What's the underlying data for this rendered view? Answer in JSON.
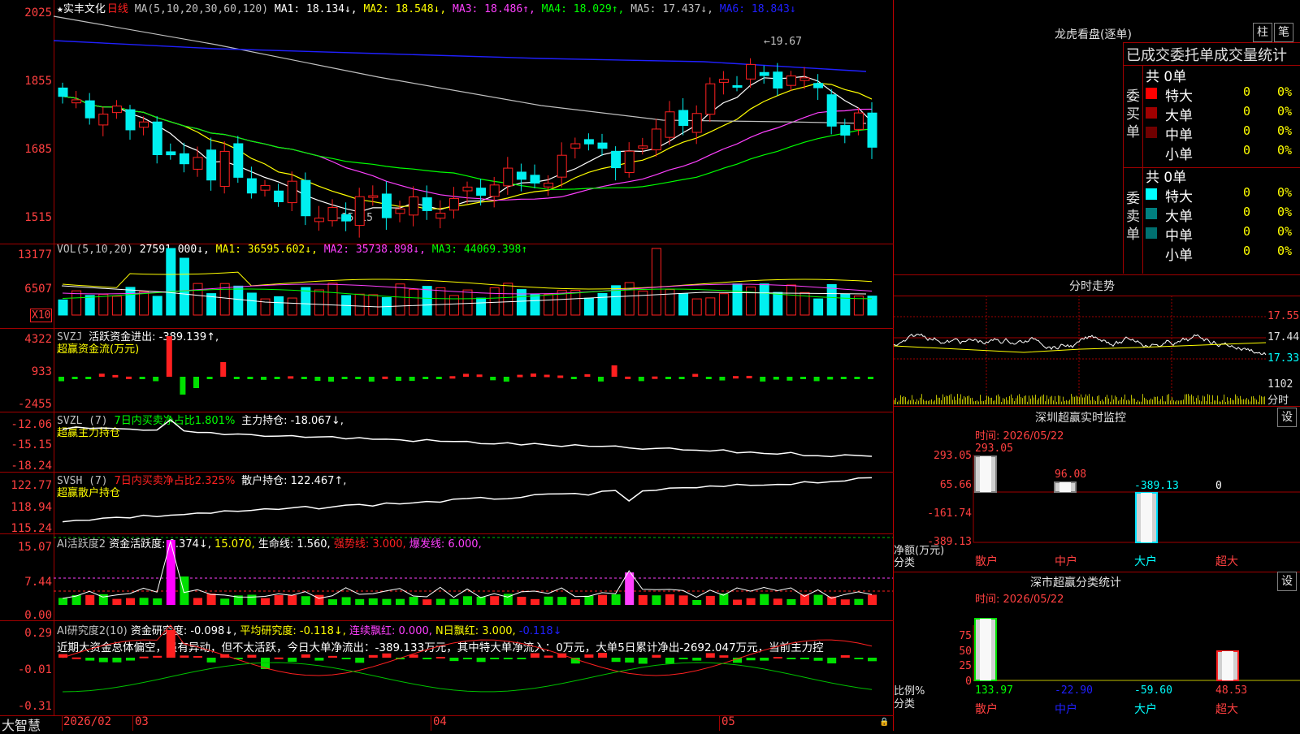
{
  "colors": {
    "up": "#ff2020",
    "down": "#00f0f0",
    "ma1": "#ffffff",
    "ma2": "#ffff00",
    "ma3": "#ff40ff",
    "ma4": "#00ff00",
    "ma5": "#c0c0c0",
    "ma6": "#2020ff"
  },
  "kline": {
    "title_star": "★",
    "stock": "实丰文化",
    "period": "日线",
    "ma_params": "MA(5,10,20,30,60,120)",
    "ma1": "MA1: 18.134↓,",
    "ma2": "MA2: 18.548↓,",
    "ma3": "MA3: 18.486↑,",
    "ma4": "MA4: 18.029↑,",
    "ma5": "MA5: 17.437↓,",
    "ma6": "MA6: 18.843↓",
    "yticks": [
      "2025",
      "1855",
      "1685",
      "1515"
    ],
    "high_mark": "19.67",
    "low_mark": "15.15"
  },
  "vol": {
    "title": "VOL(5,10,20)",
    "value": "27591.000↓,",
    "ma1": "MA1: 36595.602↓,",
    "ma2": "MA2: 35738.898↓,",
    "ma3": "MA3: 44069.398↑",
    "yticks": [
      "13177",
      "6507"
    ],
    "unit": "X10"
  },
  "svzj": {
    "title": "SVZJ",
    "label": "活跃资金进出: -389.139↑,",
    "sub": "超赢资金流(万元)",
    "yticks": [
      "4322",
      "933",
      "-2455"
    ]
  },
  "svzl": {
    "title": "SVZL (7)",
    "label1": "7日内买卖净占比1.801%",
    "label2": "主力持仓: -18.067↓,",
    "sub": "超赢主力持仓",
    "yticks": [
      "-12.06",
      "-15.15",
      "-18.24"
    ]
  },
  "svsh": {
    "title": "SVSH (7)",
    "label1": "7日内买卖净占比2.325%",
    "label2": "散户持仓: 122.467↑,",
    "sub": "超赢散户持仓",
    "yticks": [
      "122.77",
      "118.94",
      "115.24"
    ]
  },
  "ai1": {
    "title": "AI活跃度2",
    "l1": "资金活跃度: 0.374↓,",
    "l2": "15.070,",
    "l3": "生命线: 1.560,",
    "l4": "强势线: 3.000,",
    "l5": "爆发线: 6.000,",
    "yticks": [
      "15.07",
      "7.44",
      "0.00"
    ]
  },
  "ai2": {
    "title": "AI研究度2(10)",
    "l1": "资金研究度: -0.098↓,",
    "l2": "平均研究度: -0.118↓,",
    "l3": "连续飘红: 0.000,",
    "l4": "N日飘红: 3.000,",
    "l5": "-0.118↓",
    "comment": "近期大资金总体偏空，虽有异动，但不太活跃，今日大单净流出：-389.133万元，其中特大单净流入：0万元，大单5日累计净出-2692.047万元，当前主力控",
    "yticks": [
      "0.29",
      "-0.01",
      "-0.31"
    ]
  },
  "xaxis": {
    "labels": [
      "2026/02",
      "03",
      "04",
      "05"
    ],
    "brand": "大智慧"
  },
  "lhb": {
    "title": "龙虎看盘(逐单)",
    "btn1": "柱",
    "btn2": "笔",
    "header": "已成交委托单成交量统计",
    "buy": {
      "side": "委买单",
      "total": "共 0单",
      "rows": [
        {
          "name": "特大",
          "n": "0",
          "p": "0%",
          "c": "#ff0000"
        },
        {
          "name": "大单",
          "n": "0",
          "p": "0%",
          "c": "#a00000"
        },
        {
          "name": "中单",
          "n": "0",
          "p": "0%",
          "c": "#700000"
        },
        {
          "name": "小单",
          "n": "0",
          "p": "0%",
          "c": ""
        }
      ]
    },
    "sell": {
      "side": "委卖单",
      "total": "共 0单",
      "rows": [
        {
          "name": "特大",
          "n": "0",
          "p": "0%",
          "c": "#00ffff"
        },
        {
          "name": "大单",
          "n": "0",
          "p": "0%",
          "c": "#008080"
        },
        {
          "name": "中单",
          "n": "0",
          "p": "0%",
          "c": "#007070"
        },
        {
          "name": "小单",
          "n": "0",
          "p": "0%",
          "c": ""
        }
      ]
    }
  },
  "fenshi": {
    "title": "分时走势",
    "yticks": [
      "17.55",
      "17.44",
      "17.33"
    ],
    "vol_label": "1102",
    "vol_unit": "分时"
  },
  "sz_monitor": {
    "title": "深圳超赢实时监控",
    "btn": "设",
    "time": "时间: 2026/05/22",
    "yticks": [
      "293.05",
      "65.66",
      "-161.74",
      "-389.13"
    ],
    "values": [
      "293.05",
      "96.08",
      "-389.13",
      "0"
    ],
    "ylabel": "净额(万元)",
    "xcaption": "分类",
    "cats": [
      "散户",
      "中户",
      "大户",
      "超大"
    ]
  },
  "sz_stat": {
    "title": "深市超赢分类统计",
    "btn": "设",
    "time": "时间: 2026/05/22",
    "yticks": [
      "75",
      "50",
      "25",
      "0"
    ],
    "values": [
      "133.97",
      "-22.90",
      "-59.60",
      "48.53"
    ],
    "ylabel": "比例%",
    "xcaption": "分类",
    "cats": [
      "散户",
      "中户",
      "大户",
      "超大"
    ]
  }
}
